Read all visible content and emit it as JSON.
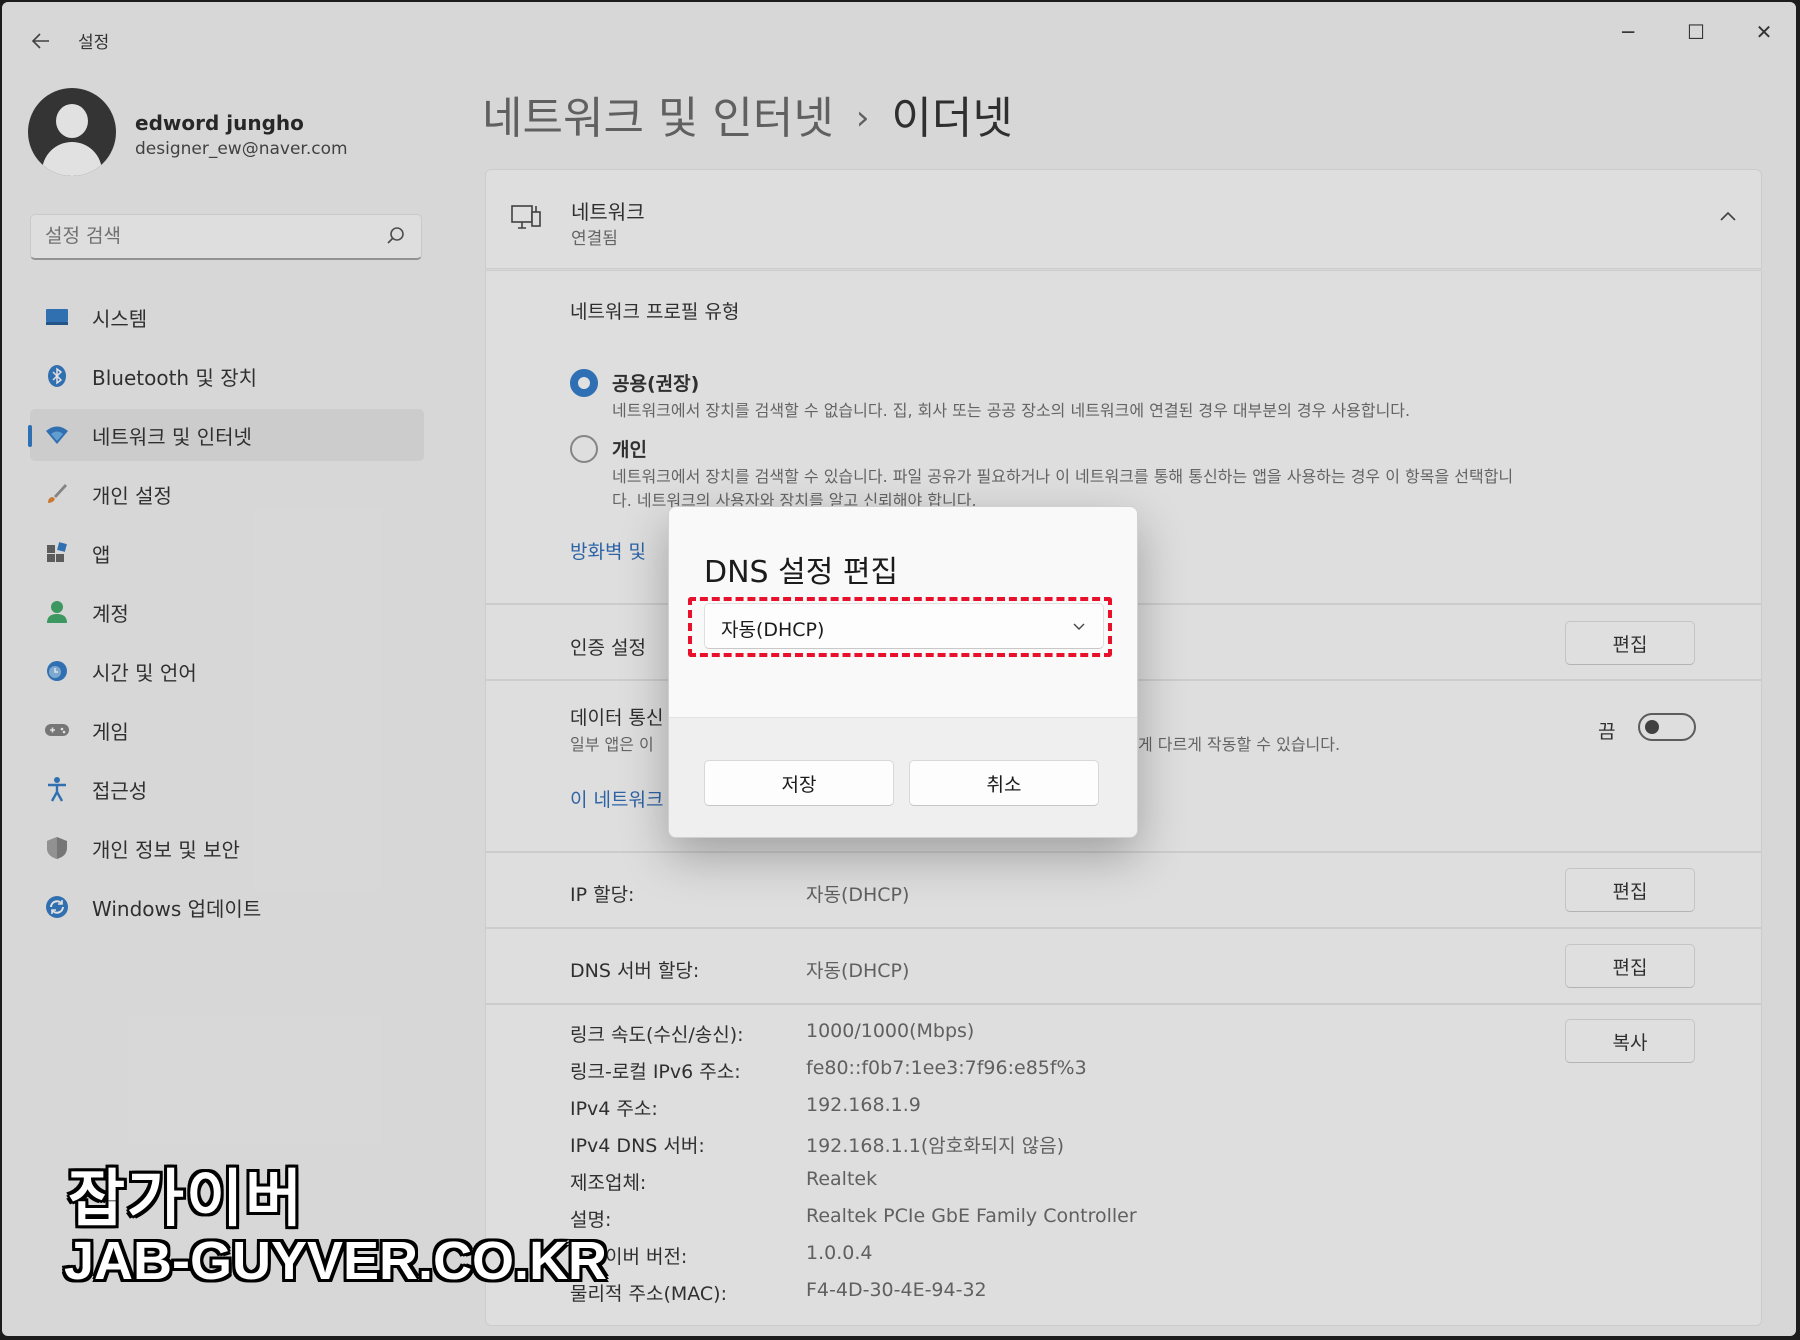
{
  "app": {
    "title": "설정",
    "back_icon": "back-arrow-icon"
  },
  "window_controls": {
    "minimize": "─",
    "maximize": "☐",
    "close": "✕"
  },
  "user": {
    "name": "edword jungho",
    "email": "designer_ew@naver.com"
  },
  "search": {
    "placeholder": "설정 검색"
  },
  "sidebar": {
    "items": [
      {
        "label": "시스템",
        "icon": "system-icon",
        "active": false
      },
      {
        "label": "Bluetooth 및 장치",
        "icon": "bluetooth-icon",
        "active": false
      },
      {
        "label": "네트워크 및 인터넷",
        "icon": "wifi-icon",
        "active": true
      },
      {
        "label": "개인 설정",
        "icon": "brush-icon",
        "active": false
      },
      {
        "label": "앱",
        "icon": "apps-icon",
        "active": false
      },
      {
        "label": "계정",
        "icon": "account-icon",
        "active": false
      },
      {
        "label": "시간 및 언어",
        "icon": "clock-globe-icon",
        "active": false
      },
      {
        "label": "게임",
        "icon": "gamepad-icon",
        "active": false
      },
      {
        "label": "접근성",
        "icon": "accessibility-icon",
        "active": false
      },
      {
        "label": "개인 정보 및 보안",
        "icon": "shield-icon",
        "active": false
      },
      {
        "label": "Windows 업데이트",
        "icon": "update-icon",
        "active": false
      }
    ]
  },
  "breadcrumb": {
    "parent": "네트워크 및 인터넷",
    "separator": "›",
    "current": "이더넷"
  },
  "network": {
    "title": "네트워크",
    "status": "연결됨",
    "profile_heading": "네트워크 프로필 유형",
    "options": [
      {
        "label": "공용(권장)",
        "desc": "네트워크에서 장치를 검색할 수 없습니다. 집, 회사 또는 공공 장소의 네트워크에 연결된 경우 대부분의 경우 사용합니다.",
        "selected": true
      },
      {
        "label": "개인",
        "desc_line1": "네트워크에서 장치를 검색할 수 있습니다. 파일 공유가 필요하거나 이 네트워크를 통해 통신하는 앱을 사용하는 경우 이 항목을 선택합니",
        "desc_line2": "다. 네트워크의 사용자와 장치를 알고 신뢰해야 합니다.",
        "selected": false
      }
    ],
    "firewall_link": "방화벽 및",
    "auth_label": "인증 설정",
    "auth_button": "편집",
    "metered_label": "데이터 통신",
    "metered_desc_left": "일부 앱은 이",
    "metered_desc_right": "게 다르게 작동할 수 있습니다.",
    "metered_state": "끔",
    "metered_on": false,
    "network_link": "이 네트워크"
  },
  "ip": {
    "label": "IP 할당:",
    "value": "자동(DHCP)",
    "button": "편집"
  },
  "dns": {
    "label": "DNS 서버 할당:",
    "value": "자동(DHCP)",
    "button": "편집"
  },
  "properties": {
    "copy_button": "복사",
    "rows": [
      {
        "label": "링크 속도(수신/송신):",
        "value": "1000/1000(Mbps)"
      },
      {
        "label": "링크-로컬 IPv6 주소:",
        "value": "fe80::f0b7:1ee3:7f96:e85f%3"
      },
      {
        "label": "IPv4 주소:",
        "value": "192.168.1.9"
      },
      {
        "label": "IPv4 DNS 서버:",
        "value": "192.168.1.1(암호화되지 않음)"
      },
      {
        "label": "제조업체:",
        "value": "Realtek"
      },
      {
        "label": "설명:",
        "value": "Realtek PCIe GbE Family Controller"
      },
      {
        "label": "드라이버 버전:",
        "value": "1.0.0.4"
      },
      {
        "label": "물리적 주소(MAC):",
        "value": "F4-4D-30-4E-94-32"
      }
    ]
  },
  "dialog": {
    "title": "DNS 설정 편집",
    "selected_option": "자동(DHCP)",
    "save_label": "저장",
    "cancel_label": "취소"
  },
  "watermark": {
    "line1": "잡가이버",
    "line2": "JAB-GUYVER.CO.KR"
  },
  "colors": {
    "accent": "#1a6fc5",
    "highlight": "#e8102a",
    "link": "#1a5fb4"
  }
}
